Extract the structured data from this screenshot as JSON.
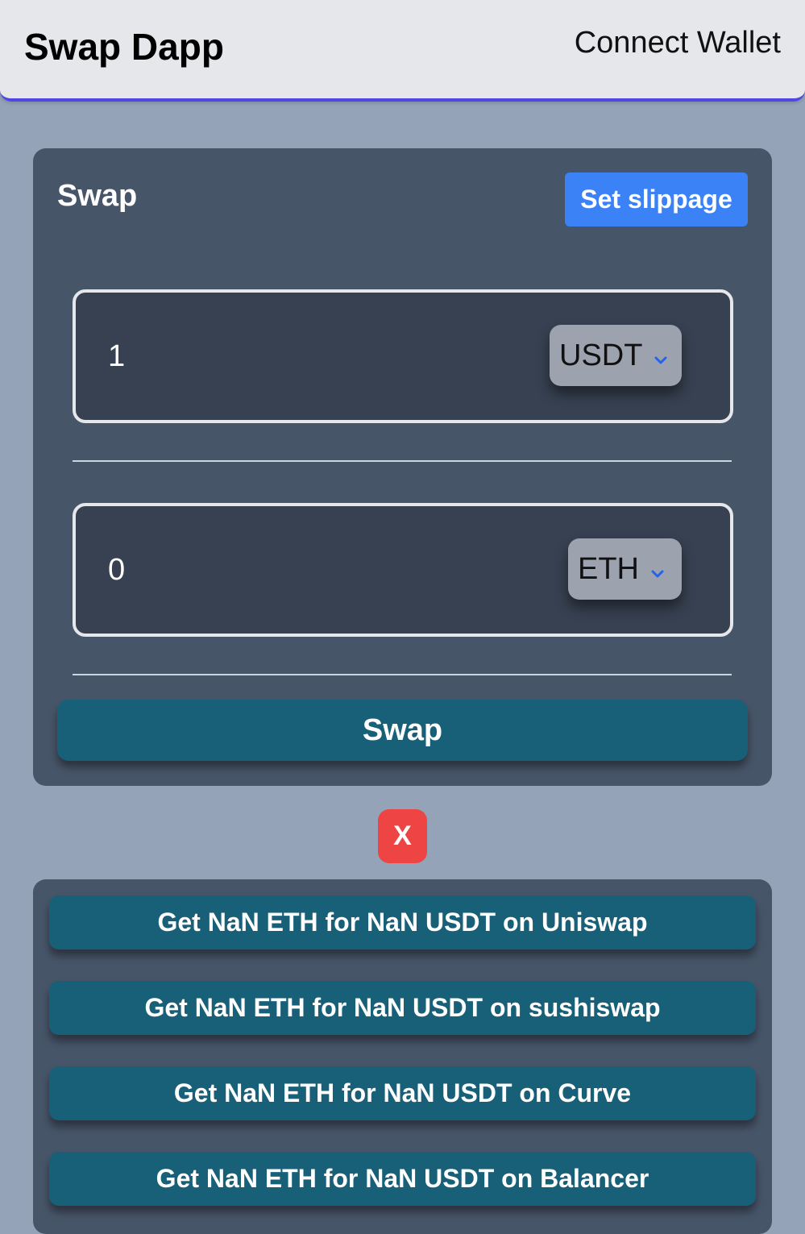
{
  "header": {
    "title": "Swap Dapp",
    "connect_label": "Connect Wallet"
  },
  "swap_card": {
    "heading": "Swap",
    "slippage_label": "Set slippage",
    "from": {
      "amount": "1",
      "token": "USDT"
    },
    "to": {
      "amount": "0",
      "token": "ETH"
    },
    "swap_label": "Swap"
  },
  "close_label": "X",
  "quotes": [
    "Get NaN ETH for NaN USDT on Uniswap",
    "Get NaN ETH for NaN USDT on sushiswap",
    "Get NaN ETH for NaN USDT on Curve",
    "Get NaN ETH for NaN USDT on Balancer"
  ],
  "colors": {
    "header_bg": "#e5e7eb",
    "header_border": "#4f46e5",
    "page_bg": "#94a3b8",
    "card_bg": "#475569",
    "primary_blue": "#3b82f6",
    "teal_button": "#185f78",
    "close_red": "#ef4444",
    "chevron": "#2563eb"
  },
  "icons": {
    "token_dropdown": "chevron-down-icon"
  }
}
